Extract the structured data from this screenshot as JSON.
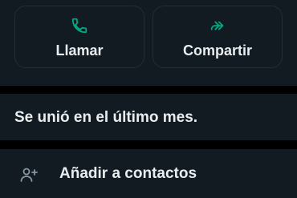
{
  "actions": {
    "call_label": "Llamar",
    "share_label": "Compartir"
  },
  "info": {
    "joined_text": "Se unió en el último mes."
  },
  "contacts": {
    "add_label": "Añadir a contactos"
  },
  "colors": {
    "accent": "#00a884",
    "panel": "#111b21",
    "text": "#e9edef",
    "icon_muted": "#8696a0"
  },
  "icons": {
    "call": "phone-icon",
    "share": "forward-icon",
    "add_contact": "add-person-icon"
  }
}
